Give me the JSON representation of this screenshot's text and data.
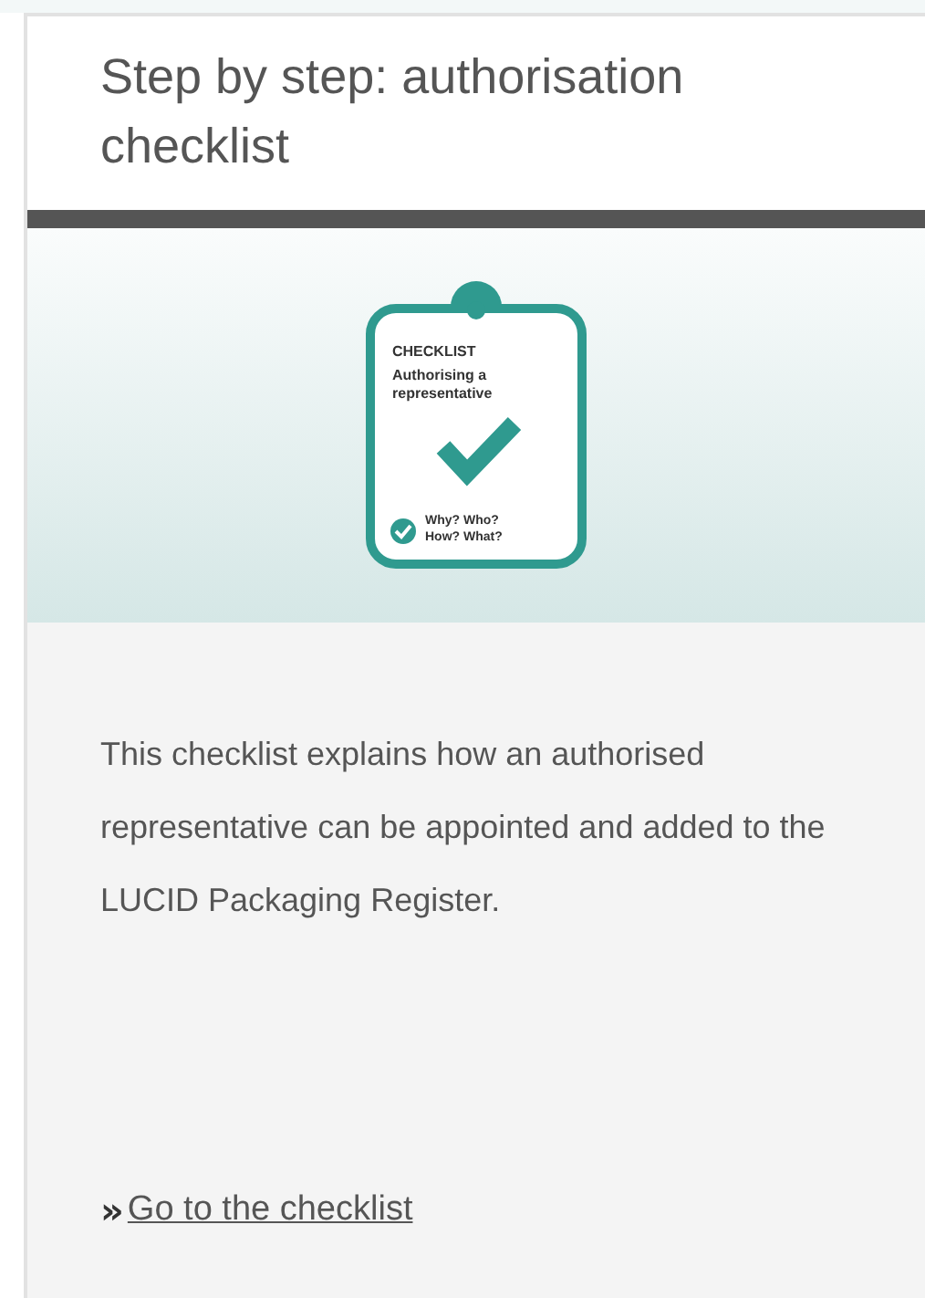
{
  "card": {
    "title": "Step by step: authorisation checklist",
    "illustration": {
      "heading": "CHECKLIST",
      "subtitle": "Authorising a representative",
      "questions": "Why? Who? How? What?"
    },
    "description": "This checklist explains how an authorised representative can be appointed and added to the LUCID Packaging Register.",
    "link": {
      "marker": "»",
      "label": "Go to the checklist"
    }
  }
}
